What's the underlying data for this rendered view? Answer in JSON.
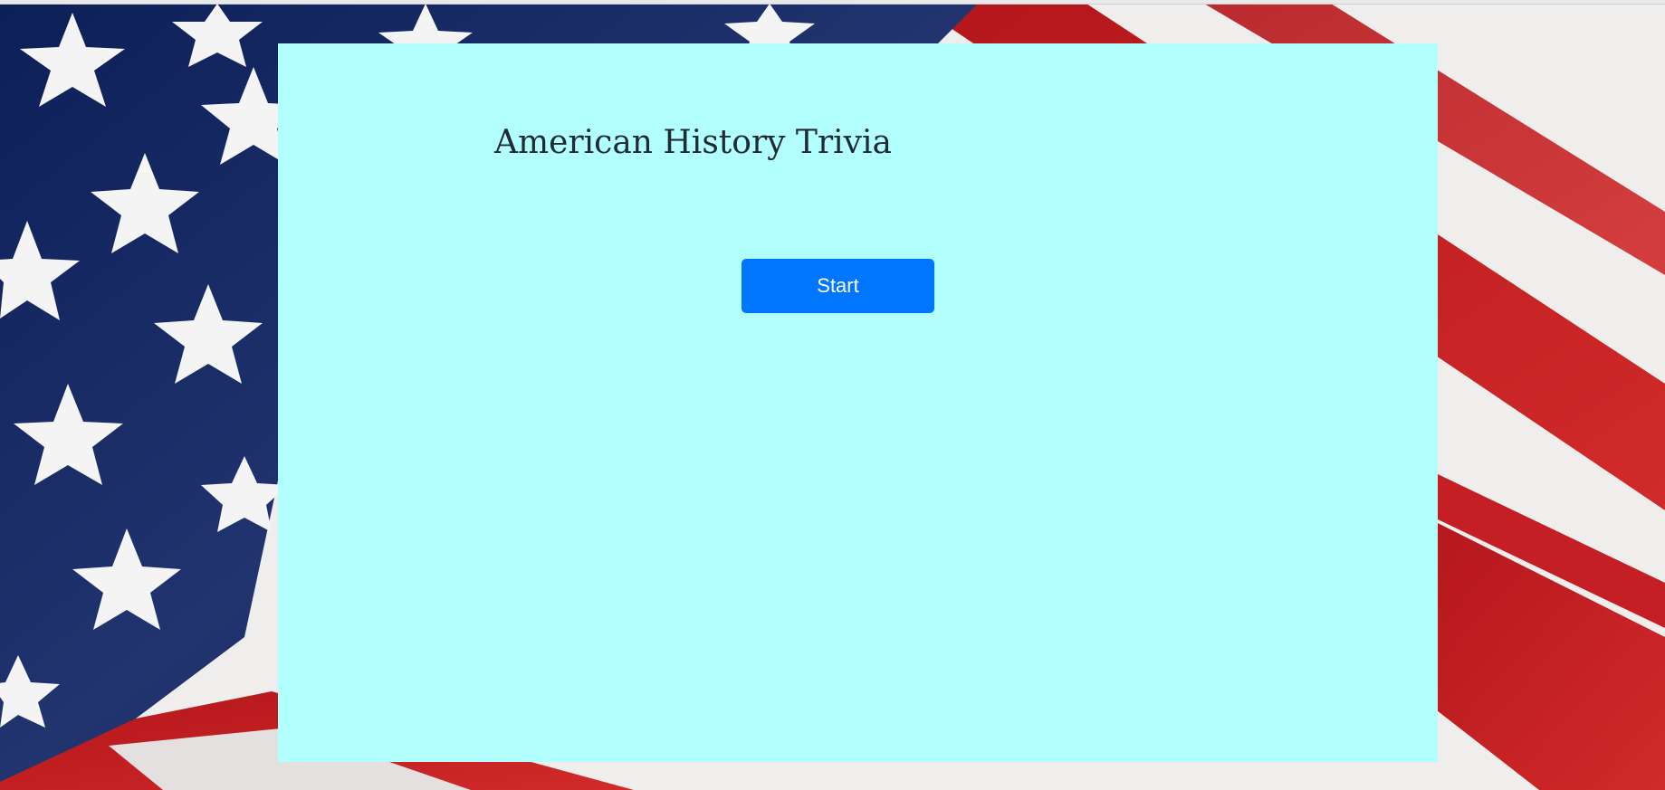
{
  "page": {
    "title": "American History Trivia",
    "start_label": "Start",
    "background": "american-flag",
    "card_color": "#b2ffff",
    "button_color": "#0076ff"
  }
}
